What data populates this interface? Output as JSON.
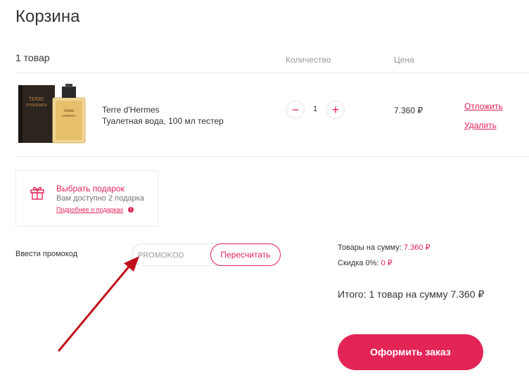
{
  "page": {
    "title": "Корзина"
  },
  "cart": {
    "count_label": "1 товар",
    "headers": {
      "quantity": "Количество",
      "price": "Цена"
    },
    "item": {
      "name": "Terre d'Hermes",
      "description": "Туалетная вода, 100 мл тестер",
      "quantity": "1",
      "price": "7.360 ₽",
      "postpone_label": "Отложить",
      "delete_label": "Удалить",
      "minus_symbol": "−",
      "plus_symbol": "+",
      "image_icon": "perfume-box-and-bottle"
    }
  },
  "gift": {
    "title": "Выбрать подарок",
    "available": "Вам доступно 2 подарка",
    "more_link": "Подробнее о подарках",
    "icon": "gift-icon"
  },
  "promo": {
    "label": "Ввести промокод",
    "placeholder": "PROMOKOD",
    "value": "",
    "recalc_label": "Пересчитать"
  },
  "summary": {
    "goods_label": "Товары на сумму:",
    "goods_value": "7.360 ₽",
    "discount_label": "Скидка 0%:",
    "discount_value": "0 ₽",
    "total": "Итого: 1 товар на сумму 7.360 ₽",
    "order_button": "Оформить заказ"
  },
  "colors": {
    "accent": "#e22457",
    "arrow": "#c0111a",
    "muted": "#999999",
    "border": "#ececec"
  }
}
